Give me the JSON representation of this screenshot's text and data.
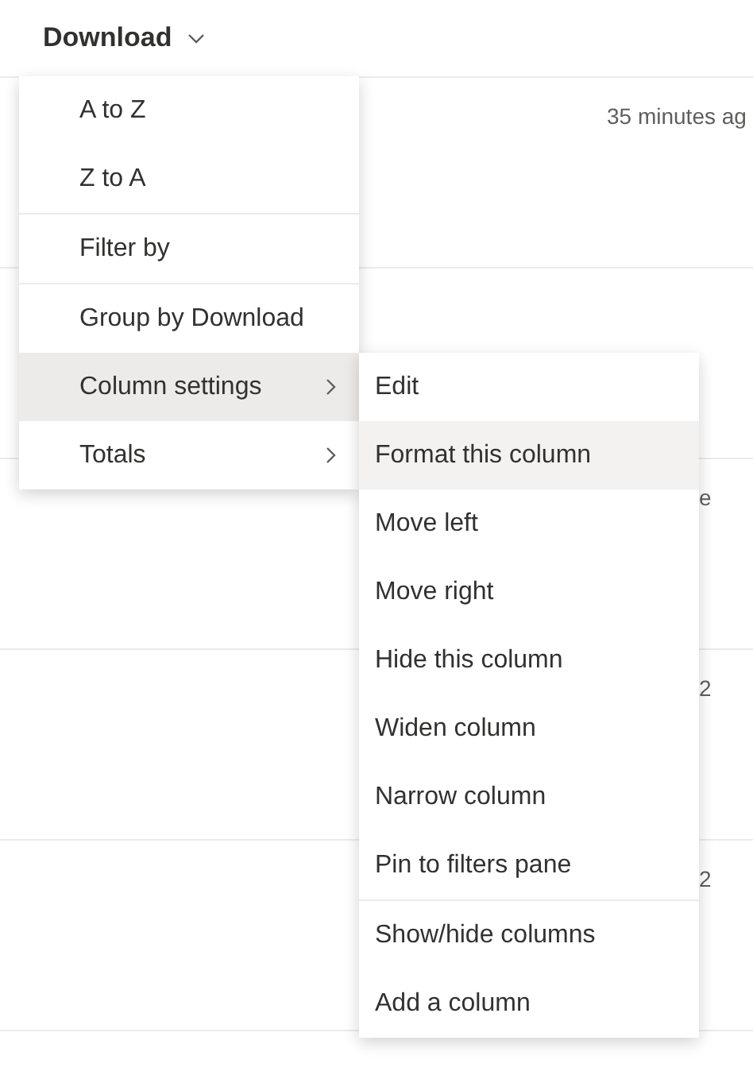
{
  "header": {
    "label": "Download"
  },
  "rows": [
    {
      "kind": "time",
      "column_2": "35 minutes ag"
    },
    {},
    {
      "kind": "date",
      "column_2": "e"
    },
    {
      "kind": "date",
      "column_2": "2"
    },
    {
      "kind": "date",
      "column_2": "2"
    }
  ],
  "menu": {
    "groups": [
      [
        {
          "label": "A to Z",
          "selected": false,
          "submenu": false
        },
        {
          "label": "Z to A",
          "selected": false,
          "submenu": false
        }
      ],
      [
        {
          "label": "Filter by",
          "selected": false,
          "submenu": false
        }
      ],
      [
        {
          "label": "Group by Download",
          "selected": false,
          "submenu": false
        },
        {
          "label": "Column settings",
          "selected": true,
          "submenu": true
        },
        {
          "label": "Totals",
          "selected": false,
          "submenu": true
        }
      ]
    ]
  },
  "submenu": {
    "groups": [
      [
        {
          "label": "Edit",
          "selected": false
        },
        {
          "label": "Format this column",
          "selected": true
        },
        {
          "label": "Move left",
          "selected": false
        },
        {
          "label": "Move right",
          "selected": false
        },
        {
          "label": "Hide this column",
          "selected": false
        },
        {
          "label": "Widen column",
          "selected": false
        },
        {
          "label": "Narrow column",
          "selected": false
        },
        {
          "label": "Pin to filters pane",
          "selected": false
        }
      ],
      [
        {
          "label": "Show/hide columns",
          "selected": false
        },
        {
          "label": "Add a column",
          "selected": false
        }
      ]
    ]
  }
}
